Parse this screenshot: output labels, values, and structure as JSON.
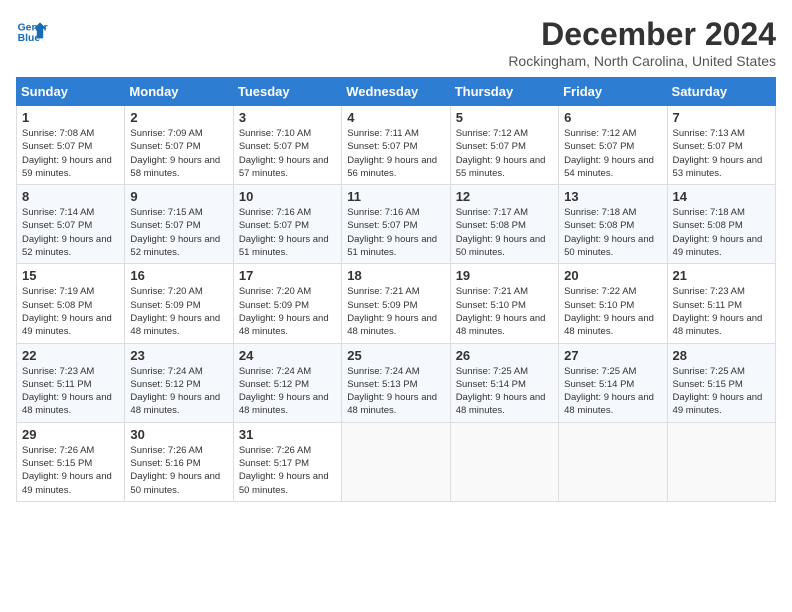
{
  "header": {
    "logo_line1": "General",
    "logo_line2": "Blue",
    "month_year": "December 2024",
    "location": "Rockingham, North Carolina, United States"
  },
  "weekdays": [
    "Sunday",
    "Monday",
    "Tuesday",
    "Wednesday",
    "Thursday",
    "Friday",
    "Saturday"
  ],
  "weeks": [
    [
      {
        "day": "1",
        "sunrise": "Sunrise: 7:08 AM",
        "sunset": "Sunset: 5:07 PM",
        "daylight": "Daylight: 9 hours and 59 minutes."
      },
      {
        "day": "2",
        "sunrise": "Sunrise: 7:09 AM",
        "sunset": "Sunset: 5:07 PM",
        "daylight": "Daylight: 9 hours and 58 minutes."
      },
      {
        "day": "3",
        "sunrise": "Sunrise: 7:10 AM",
        "sunset": "Sunset: 5:07 PM",
        "daylight": "Daylight: 9 hours and 57 minutes."
      },
      {
        "day": "4",
        "sunrise": "Sunrise: 7:11 AM",
        "sunset": "Sunset: 5:07 PM",
        "daylight": "Daylight: 9 hours and 56 minutes."
      },
      {
        "day": "5",
        "sunrise": "Sunrise: 7:12 AM",
        "sunset": "Sunset: 5:07 PM",
        "daylight": "Daylight: 9 hours and 55 minutes."
      },
      {
        "day": "6",
        "sunrise": "Sunrise: 7:12 AM",
        "sunset": "Sunset: 5:07 PM",
        "daylight": "Daylight: 9 hours and 54 minutes."
      },
      {
        "day": "7",
        "sunrise": "Sunrise: 7:13 AM",
        "sunset": "Sunset: 5:07 PM",
        "daylight": "Daylight: 9 hours and 53 minutes."
      }
    ],
    [
      {
        "day": "8",
        "sunrise": "Sunrise: 7:14 AM",
        "sunset": "Sunset: 5:07 PM",
        "daylight": "Daylight: 9 hours and 52 minutes."
      },
      {
        "day": "9",
        "sunrise": "Sunrise: 7:15 AM",
        "sunset": "Sunset: 5:07 PM",
        "daylight": "Daylight: 9 hours and 52 minutes."
      },
      {
        "day": "10",
        "sunrise": "Sunrise: 7:16 AM",
        "sunset": "Sunset: 5:07 PM",
        "daylight": "Daylight: 9 hours and 51 minutes."
      },
      {
        "day": "11",
        "sunrise": "Sunrise: 7:16 AM",
        "sunset": "Sunset: 5:07 PM",
        "daylight": "Daylight: 9 hours and 51 minutes."
      },
      {
        "day": "12",
        "sunrise": "Sunrise: 7:17 AM",
        "sunset": "Sunset: 5:08 PM",
        "daylight": "Daylight: 9 hours and 50 minutes."
      },
      {
        "day": "13",
        "sunrise": "Sunrise: 7:18 AM",
        "sunset": "Sunset: 5:08 PM",
        "daylight": "Daylight: 9 hours and 50 minutes."
      },
      {
        "day": "14",
        "sunrise": "Sunrise: 7:18 AM",
        "sunset": "Sunset: 5:08 PM",
        "daylight": "Daylight: 9 hours and 49 minutes."
      }
    ],
    [
      {
        "day": "15",
        "sunrise": "Sunrise: 7:19 AM",
        "sunset": "Sunset: 5:08 PM",
        "daylight": "Daylight: 9 hours and 49 minutes."
      },
      {
        "day": "16",
        "sunrise": "Sunrise: 7:20 AM",
        "sunset": "Sunset: 5:09 PM",
        "daylight": "Daylight: 9 hours and 48 minutes."
      },
      {
        "day": "17",
        "sunrise": "Sunrise: 7:20 AM",
        "sunset": "Sunset: 5:09 PM",
        "daylight": "Daylight: 9 hours and 48 minutes."
      },
      {
        "day": "18",
        "sunrise": "Sunrise: 7:21 AM",
        "sunset": "Sunset: 5:09 PM",
        "daylight": "Daylight: 9 hours and 48 minutes."
      },
      {
        "day": "19",
        "sunrise": "Sunrise: 7:21 AM",
        "sunset": "Sunset: 5:10 PM",
        "daylight": "Daylight: 9 hours and 48 minutes."
      },
      {
        "day": "20",
        "sunrise": "Sunrise: 7:22 AM",
        "sunset": "Sunset: 5:10 PM",
        "daylight": "Daylight: 9 hours and 48 minutes."
      },
      {
        "day": "21",
        "sunrise": "Sunrise: 7:23 AM",
        "sunset": "Sunset: 5:11 PM",
        "daylight": "Daylight: 9 hours and 48 minutes."
      }
    ],
    [
      {
        "day": "22",
        "sunrise": "Sunrise: 7:23 AM",
        "sunset": "Sunset: 5:11 PM",
        "daylight": "Daylight: 9 hours and 48 minutes."
      },
      {
        "day": "23",
        "sunrise": "Sunrise: 7:24 AM",
        "sunset": "Sunset: 5:12 PM",
        "daylight": "Daylight: 9 hours and 48 minutes."
      },
      {
        "day": "24",
        "sunrise": "Sunrise: 7:24 AM",
        "sunset": "Sunset: 5:12 PM",
        "daylight": "Daylight: 9 hours and 48 minutes."
      },
      {
        "day": "25",
        "sunrise": "Sunrise: 7:24 AM",
        "sunset": "Sunset: 5:13 PM",
        "daylight": "Daylight: 9 hours and 48 minutes."
      },
      {
        "day": "26",
        "sunrise": "Sunrise: 7:25 AM",
        "sunset": "Sunset: 5:14 PM",
        "daylight": "Daylight: 9 hours and 48 minutes."
      },
      {
        "day": "27",
        "sunrise": "Sunrise: 7:25 AM",
        "sunset": "Sunset: 5:14 PM",
        "daylight": "Daylight: 9 hours and 48 minutes."
      },
      {
        "day": "28",
        "sunrise": "Sunrise: 7:25 AM",
        "sunset": "Sunset: 5:15 PM",
        "daylight": "Daylight: 9 hours and 49 minutes."
      }
    ],
    [
      {
        "day": "29",
        "sunrise": "Sunrise: 7:26 AM",
        "sunset": "Sunset: 5:15 PM",
        "daylight": "Daylight: 9 hours and 49 minutes."
      },
      {
        "day": "30",
        "sunrise": "Sunrise: 7:26 AM",
        "sunset": "Sunset: 5:16 PM",
        "daylight": "Daylight: 9 hours and 50 minutes."
      },
      {
        "day": "31",
        "sunrise": "Sunrise: 7:26 AM",
        "sunset": "Sunset: 5:17 PM",
        "daylight": "Daylight: 9 hours and 50 minutes."
      },
      null,
      null,
      null,
      null
    ]
  ]
}
